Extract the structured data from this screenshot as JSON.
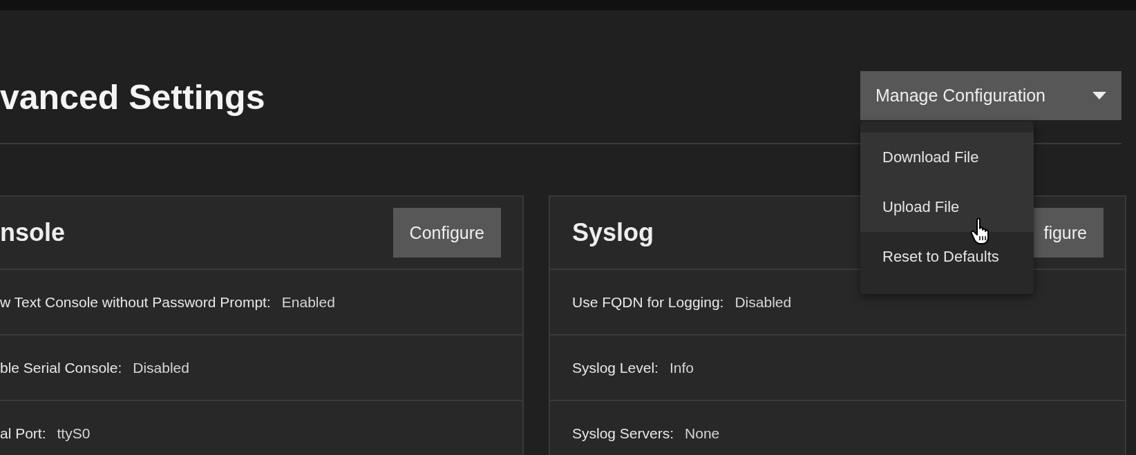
{
  "page": {
    "title": "vanced Settings"
  },
  "manage_button": {
    "label": "Manage Configuration"
  },
  "panels": [
    {
      "title": "nsole",
      "configure": "Configure",
      "rows": [
        {
          "label": "w Text Console without Password Prompt:",
          "value": "Enabled"
        },
        {
          "label": "ble Serial Console:",
          "value": "Disabled"
        },
        {
          "label": "al Port:",
          "value": "ttyS0"
        }
      ]
    },
    {
      "title": "Syslog",
      "configure": "figure",
      "rows": [
        {
          "label": "Use FQDN for Logging:",
          "value": "Disabled"
        },
        {
          "label": "Syslog Level:",
          "value": "Info"
        },
        {
          "label": "Syslog Servers:",
          "value": "None"
        }
      ]
    }
  ],
  "menu": {
    "items": [
      {
        "label": "Download File",
        "highlighted": true
      },
      {
        "label": "Upload File",
        "highlighted": true
      },
      {
        "label": "Reset to Defaults",
        "highlighted": false
      }
    ]
  }
}
